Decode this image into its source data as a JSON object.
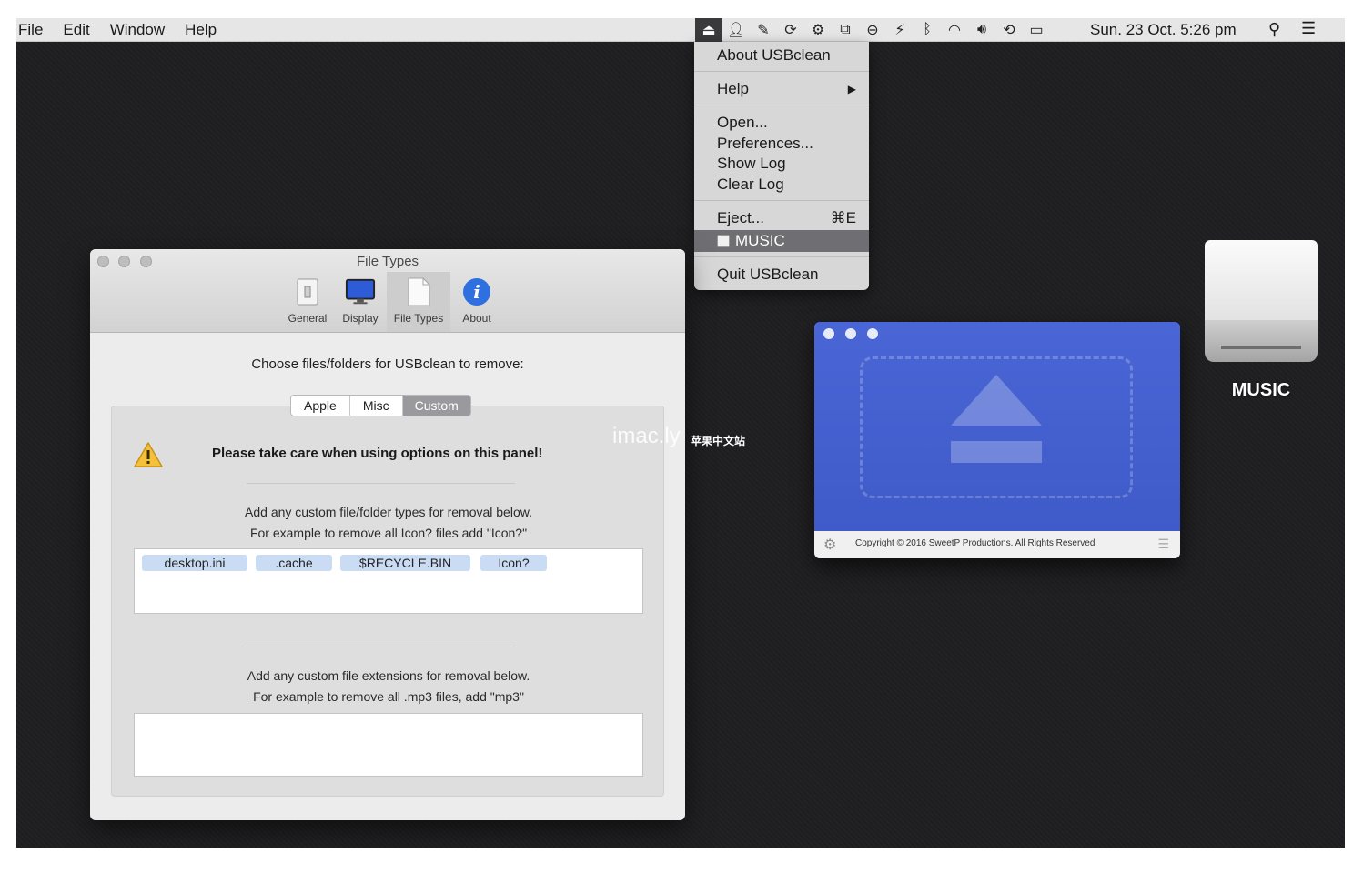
{
  "menubar": {
    "app_menus": [
      "File",
      "Edit",
      "Window",
      "Help"
    ],
    "status_icons": [
      "eject-icon",
      "user-icon",
      "feather-icon",
      "sync-icon",
      "gear-icon",
      "capture-icon",
      "minus-circle-icon",
      "bolt-icon",
      "bluetooth-icon",
      "wifi-icon",
      "volume-icon",
      "time-machine-icon",
      "airplay-icon"
    ],
    "clock": "Sun. 23 Oct.  5:26 pm"
  },
  "dropdown": {
    "about": "About USBclean",
    "help": "Help",
    "open": "Open...",
    "preferences": "Preferences...",
    "show_log": "Show Log",
    "clear_log": "Clear Log",
    "eject": "Eject...",
    "eject_shortcut": "⌘E",
    "drive_item": "MUSIC",
    "quit": "Quit USBclean"
  },
  "prefs": {
    "title": "File Types",
    "toolbar": [
      {
        "label": "General"
      },
      {
        "label": "Display"
      },
      {
        "label": "File Types"
      },
      {
        "label": "About"
      }
    ],
    "choose_text": "Choose files/folders for USBclean to remove:",
    "segments": [
      "Apple",
      "Misc",
      "Custom"
    ],
    "selected_segment": "Custom",
    "warning": "Please take care when using options on this panel!",
    "folder_desc_1": "Add any custom file/folder types for removal below.",
    "folder_desc_2": "For example to remove all Icon? files add \"Icon?\"",
    "tokens": [
      "desktop.ini",
      ".cache",
      "$RECYCLE.BIN",
      "Icon?"
    ],
    "ext_desc_1": "Add any custom file extensions for removal below.",
    "ext_desc_2": "For example to remove all .mp3 files, add \"mp3\"",
    "ext_value": ""
  },
  "app_window": {
    "copyright": "Copyright © 2016 SweetP Productions. All Rights Reserved"
  },
  "desktop": {
    "drive_label": "MUSIC"
  },
  "watermark": {
    "main": "imac.ly",
    "sub": "苹果中文站"
  },
  "colors": {
    "app_blue": "#4360cf",
    "menu_highlight": "#6f6f73",
    "token_blue": "#c9dcf4"
  }
}
